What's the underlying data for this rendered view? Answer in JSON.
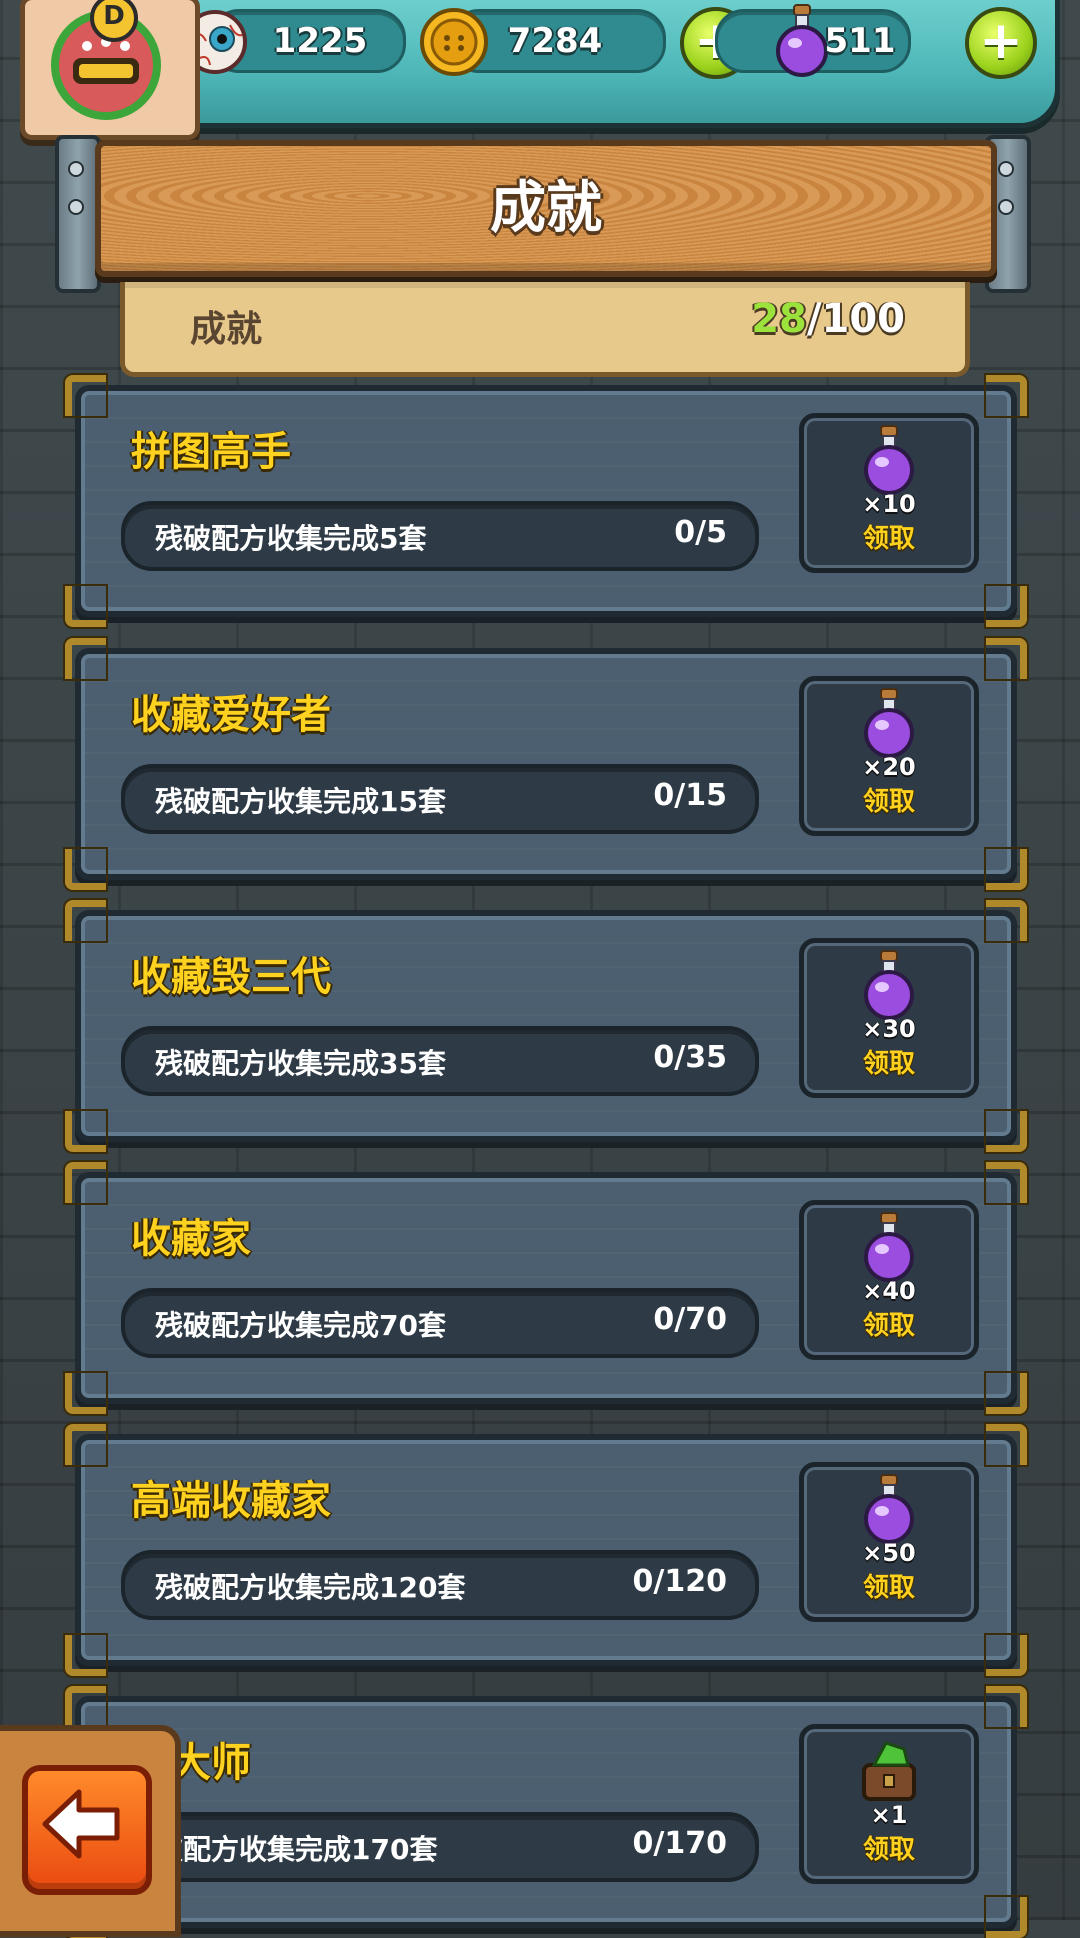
{
  "resources": {
    "eyeball": "1225",
    "coins": "7284",
    "potions": "511"
  },
  "avatar": {
    "badge": "D"
  },
  "header": {
    "title": "成就",
    "progress_label": "成就",
    "progress_done": "28",
    "progress_total": "/100"
  },
  "achievements": [
    {
      "title": "拼图高手",
      "desc": "残破配方收集完成5套",
      "progress": "0/5",
      "reward_qty": "×10",
      "reward_icon": "potion-icon",
      "claim": "领取"
    },
    {
      "title": "收藏爱好者",
      "desc": "残破配方收集完成15套",
      "progress": "0/15",
      "reward_qty": "×20",
      "reward_icon": "potion-icon",
      "claim": "领取"
    },
    {
      "title": "收藏毁三代",
      "desc": "残破配方收集完成35套",
      "progress": "0/35",
      "reward_qty": "×30",
      "reward_icon": "potion-icon",
      "claim": "领取"
    },
    {
      "title": "收藏家",
      "desc": "残破配方收集完成70套",
      "progress": "0/70",
      "reward_qty": "×40",
      "reward_icon": "potion-icon",
      "claim": "领取"
    },
    {
      "title": "高端收藏家",
      "desc": "残破配方收集完成120套",
      "progress": "0/120",
      "reward_qty": "×50",
      "reward_icon": "potion-icon",
      "claim": "领取"
    },
    {
      "title": "藏大师",
      "desc": "破配方收集完成170套",
      "progress": "0/170",
      "reward_qty": "×1",
      "reward_icon": "chest-icon",
      "claim": "领取"
    }
  ],
  "colors": {
    "accent_yellow": "#ffd21f",
    "progress_green": "#9be23c",
    "card_blue": "#4b5f70"
  }
}
